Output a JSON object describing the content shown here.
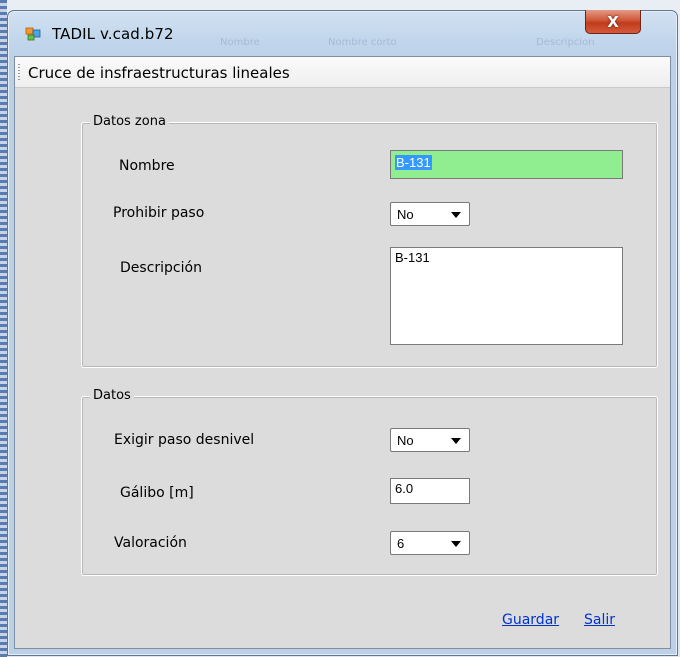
{
  "window": {
    "title": "TADIL v.cad.b72",
    "close_glyph": "X",
    "icon": "app-window-icon",
    "background_ghost": [
      "Nombre",
      "Nombre corto",
      "Descripcion"
    ]
  },
  "form": {
    "subtitle": "Cruce de insfraestructuras lineales",
    "group_zona": {
      "legend": "Datos zona",
      "nombre_label": "Nombre",
      "nombre_value": "B-131",
      "prohibir_label": "Prohibir paso",
      "prohibir_value": "No",
      "descripcion_label": "Descripción",
      "descripcion_value": "B-131"
    },
    "group_datos": {
      "legend": "Datos",
      "exigir_label": "Exigir paso desnivel",
      "exigir_value": "No",
      "galibo_label": "Gálibo [m]",
      "galibo_value": "6.0",
      "valoracion_label": "Valoración",
      "valoracion_value": "6"
    },
    "actions": {
      "guardar": "Guardar",
      "salir": "Salir"
    }
  },
  "colors": {
    "nombre_bg": "#90ee90",
    "selection": "#3399ff",
    "link": "#0033cc",
    "close_button": "#c03b1c"
  }
}
